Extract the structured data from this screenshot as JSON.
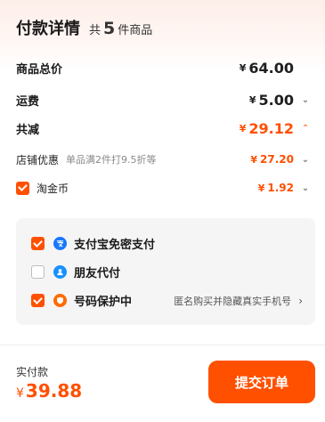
{
  "header": {
    "title": "付款详情",
    "count_prefix": "共",
    "count": "5",
    "count_suffix": "件商品"
  },
  "currency": "¥",
  "rows": {
    "total": {
      "label": "商品总价",
      "amount": "64.00"
    },
    "shipping": {
      "label": "运费",
      "amount": "5.00"
    },
    "discount": {
      "label": "共减",
      "amount": "29.12"
    },
    "store_promo": {
      "label": "店铺优惠",
      "hint": "单品满2件打9.5折等",
      "amount": "27.20"
    },
    "taojinbi": {
      "label": "淘金币",
      "amount": "1.92",
      "checked": true
    }
  },
  "options": [
    {
      "label": "支付宝免密支付",
      "checked": true,
      "icon": "alipay-icon",
      "icon_color": "#1677ff"
    },
    {
      "label": "朋友代付",
      "checked": false,
      "icon": "friend-pay-icon",
      "icon_color": "#1890ff"
    },
    {
      "label": "号码保护中",
      "checked": true,
      "icon": "shield-icon",
      "icon_color": "#ff6a00",
      "note": "匿名购买并隐藏真实手机号"
    }
  ],
  "footer": {
    "pay_label": "实付款",
    "pay_amount": "39.88",
    "submit_label": "提交订单"
  },
  "colors": {
    "accent": "#ff5000",
    "panel_bg": "#f5f5f5"
  }
}
